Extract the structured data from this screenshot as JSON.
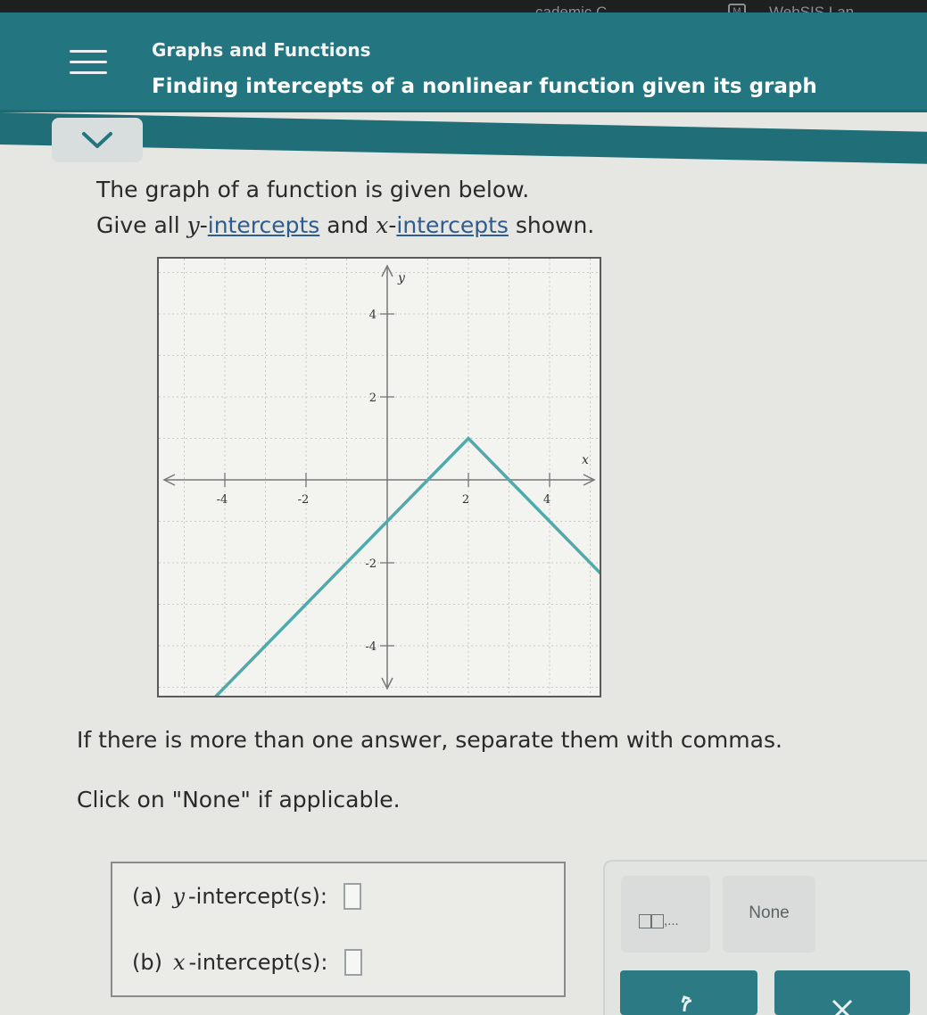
{
  "browser": {
    "tab_partial": "cademic C...",
    "tab_m": "M",
    "tab_websis": "WebSIS Lan..."
  },
  "header": {
    "topic": "Graphs and Functions",
    "title": "Finding intercepts of a nonlinear function given its graph",
    "menu_icon": "hamburger-icon"
  },
  "collapse_icon": "chevron-down-icon",
  "prompt": {
    "line1": "The graph of a function is given below.",
    "line2_prefix": "Give all ",
    "y_var": "y",
    "dash1": "-",
    "link1": "intercepts",
    "and_text": " and ",
    "x_var": "x",
    "dash2": "-",
    "link2": "intercepts",
    "suffix": " shown."
  },
  "chart_data": {
    "type": "line",
    "x_axis_label": "x",
    "y_axis_label": "y",
    "xlim": [
      -5.5,
      5.5
    ],
    "ylim": [
      -5.5,
      5.5
    ],
    "x_ticks": [
      -4,
      -2,
      2,
      4
    ],
    "x_tick_labels": [
      "-4",
      "-2",
      "2",
      "4"
    ],
    "y_ticks": [
      4,
      2,
      -2,
      -4
    ],
    "y_tick_labels": [
      "4",
      "2",
      "-2",
      "-4"
    ],
    "grid": true,
    "grid_step": 1,
    "line_color": "#4fa9ad",
    "series": [
      {
        "points": [
          [
            -4.5,
            -5.5
          ],
          [
            2,
            1
          ],
          [
            5.5,
            -2.5
          ]
        ]
      }
    ]
  },
  "instructions": {
    "line1": "If there is more than one answer, separate them with commas.",
    "line2": "Click on \"None\" if applicable."
  },
  "answers": {
    "a_label": "(a)",
    "a_var": "y",
    "a_text": "-intercept(s):",
    "b_label": "(b)",
    "b_var": "x",
    "b_text": "-intercept(s):"
  },
  "keypad": {
    "comma_key_glyph": ",...",
    "none_label": "None",
    "undo_icon": "undo-icon",
    "clear_icon": "close-icon"
  },
  "colors": {
    "header": "#23757f",
    "accent_button": "#2c7a84",
    "graph_line": "#4fa9ad",
    "link": "#2e5c8f"
  }
}
